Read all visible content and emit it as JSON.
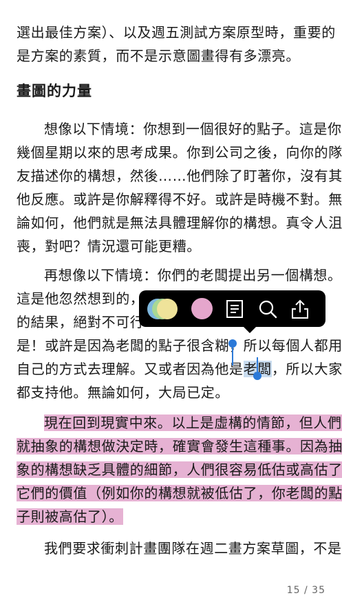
{
  "reader": {
    "paragraph_top": {
      "line1": "選出最佳方案）、以及週五測試方案原型時，重要的",
      "line2": "是方案的素質，而不是示意圖畫得有多漂亮。"
    },
    "heading": "畫圖的力量",
    "paragraph_1": {
      "line1": "想像以下情境：你想到一個很好的點子。這是你",
      "line2": "幾個星期以來的思考成果。你到公司之後，向你的隊",
      "line3": "友描述你的構想，然後……他們除了盯著你，沒有其",
      "line4": "他反應。或許是你解釋得不好。或許是時機不對。無",
      "line5": "論如何，他們就是無法具體理解你的構想。真令人沮",
      "line6": "喪，對吧？情況還可能更糟。"
    },
    "paragraph_2": {
      "line1": "再想像以下情境：你們的老闆提出另一個構想。",
      "line2": "這是他忽然想到的，",
      "line3": "的結果，絕對不可行",
      "line4a": "是！或許是因為老闆的點子很含糊，",
      "line4b": "所以每個人都用",
      "line5a": "自己的方式去理解。又或者因為他是",
      "line5_selected": "老闆",
      "line5b": "，所以大家",
      "line6": "都支持他。無論如何，大局已定。"
    },
    "paragraph_3": {
      "line1": "現在回到現實中來。以上是虛構的情節，但人們",
      "line2": "就抽象的構想做決定時，確實會發生這種事。因為抽",
      "line3": "象的構想缺乏具體的細節，人們很容易低估或高估了",
      "line4": "它們的價值（例如你的構想就被低估了，你老闆的點",
      "line5": "子則被高估了）。"
    },
    "paragraph_4": {
      "line1": "我們要求衝刺計畫團隊在週二畫方案草圖，不是"
    },
    "page_indicator": "15 / 35"
  },
  "popup_menu": {
    "items": [
      "highlight-color-picker",
      "pink-highlight",
      "note",
      "search",
      "share"
    ]
  },
  "colors": {
    "highlight_pink": "#e6b2d3",
    "selection_blue": "#c9dcef",
    "handle_blue": "#2b79d8",
    "popup_bg": "#000000"
  }
}
